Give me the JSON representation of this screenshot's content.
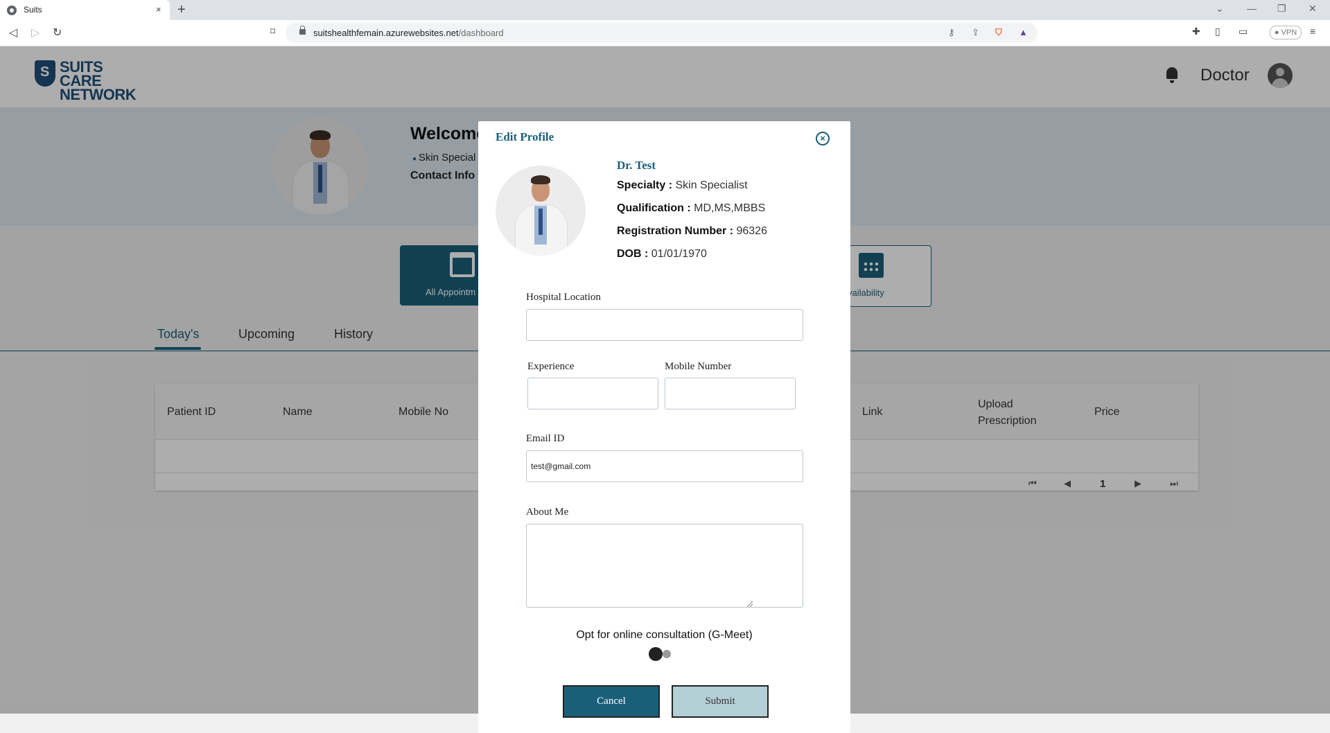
{
  "browser": {
    "tab_title": "Suits",
    "tab_close": "×",
    "new_tab": "+",
    "url_domain": "suitshealthfemain.azurewebsites.net",
    "url_path": "/dashboard",
    "vpn_label": "● VPN"
  },
  "header": {
    "logo_line1": "SUITS CARE",
    "logo_line2": "NETWORK",
    "role_label": "Doctor"
  },
  "hero": {
    "welcome": "Welcome",
    "specialty": "Skin Special",
    "contact_label": "Contact Info :"
  },
  "cards": {
    "appointments_label": "All Appointm",
    "availability_label": "vailability"
  },
  "tabs": [
    "Today's",
    "Upcoming",
    "History"
  ],
  "table": {
    "headers": [
      "Patient ID",
      "Name",
      "Mobile No",
      "Link",
      "Upload Prescription",
      "Price"
    ],
    "pagination": {
      "first": "⏮",
      "prev": "◀",
      "page": "1",
      "next": "▶",
      "last": "⏭"
    }
  },
  "modal": {
    "title": "Edit Profile",
    "close_icon": "×",
    "doctor": {
      "name": "Dr. Test",
      "specialty_label": "Specialty :",
      "specialty_value": "Skin Specialist",
      "qualification_label": "Qualification :",
      "qualification_value": "MD,MS,MBBS",
      "registration_label": "Registration Number :",
      "registration_value": "96326",
      "dob_label": "DOB :",
      "dob_value": "01/01/1970"
    },
    "form": {
      "hospital_location_label": "Hospital Location",
      "hospital_location_value": "",
      "experience_label": "Experience",
      "experience_value": "",
      "mobile_label": "Mobile Number",
      "mobile_value": "",
      "email_label": "Email ID",
      "email_value": "test@gmail.com",
      "about_label": "About Me",
      "about_value": "",
      "online_consult_label": "Opt for online consultation (G-Meet)",
      "online_consult_enabled": false
    },
    "buttons": {
      "cancel": "Cancel",
      "submit": "Submit"
    }
  },
  "colors": {
    "primary": "#1a5f7a",
    "submit_bg": "#b5cfd6",
    "hero_bg": "#dde7f0"
  },
  "icons": [
    "lock-icon",
    "bell-icon",
    "user-avatar-icon",
    "calendar-icon",
    "close-circle-icon"
  ]
}
